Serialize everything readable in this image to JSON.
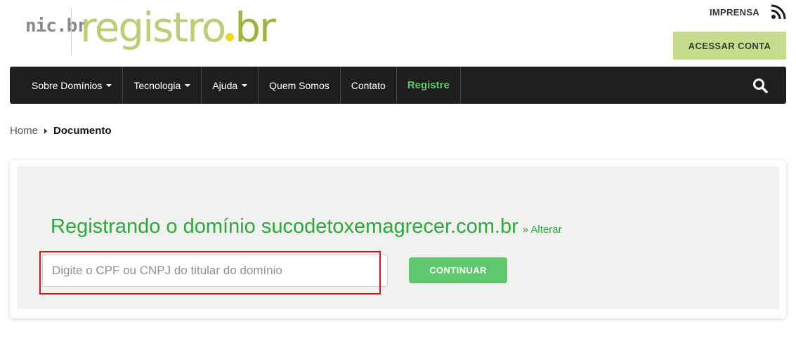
{
  "header": {
    "logo_nic": "nic.br",
    "logo_registro": "registro",
    "logo_br": "br",
    "press_label": "IMPRENSA",
    "account_button": "ACESSAR CONTA"
  },
  "nav": {
    "items": [
      {
        "label": "Sobre Domínios",
        "dropdown": true
      },
      {
        "label": "Tecnologia",
        "dropdown": true
      },
      {
        "label": "Ajuda",
        "dropdown": true
      },
      {
        "label": "Quem Somos",
        "dropdown": false
      },
      {
        "label": "Contato",
        "dropdown": false
      },
      {
        "label": "Registre",
        "dropdown": false
      }
    ],
    "search_icon": "search-icon"
  },
  "breadcrumb": {
    "home": "Home",
    "current": "Documento"
  },
  "main": {
    "title": "Registrando o domínio sucodetoxemagrecer.com.br",
    "change_link": "» Alterar",
    "document_input": {
      "value": "",
      "placeholder": "Digite o CPF ou CNPJ do titular do domínio"
    },
    "continue_button": "CONTINUAR"
  },
  "colors": {
    "accent_green": "#2da83a",
    "button_green": "#5fc86f",
    "account_button_bg": "#c5dc8c",
    "nav_bg": "#1e1e1e",
    "highlight_border": "#e0101a"
  }
}
